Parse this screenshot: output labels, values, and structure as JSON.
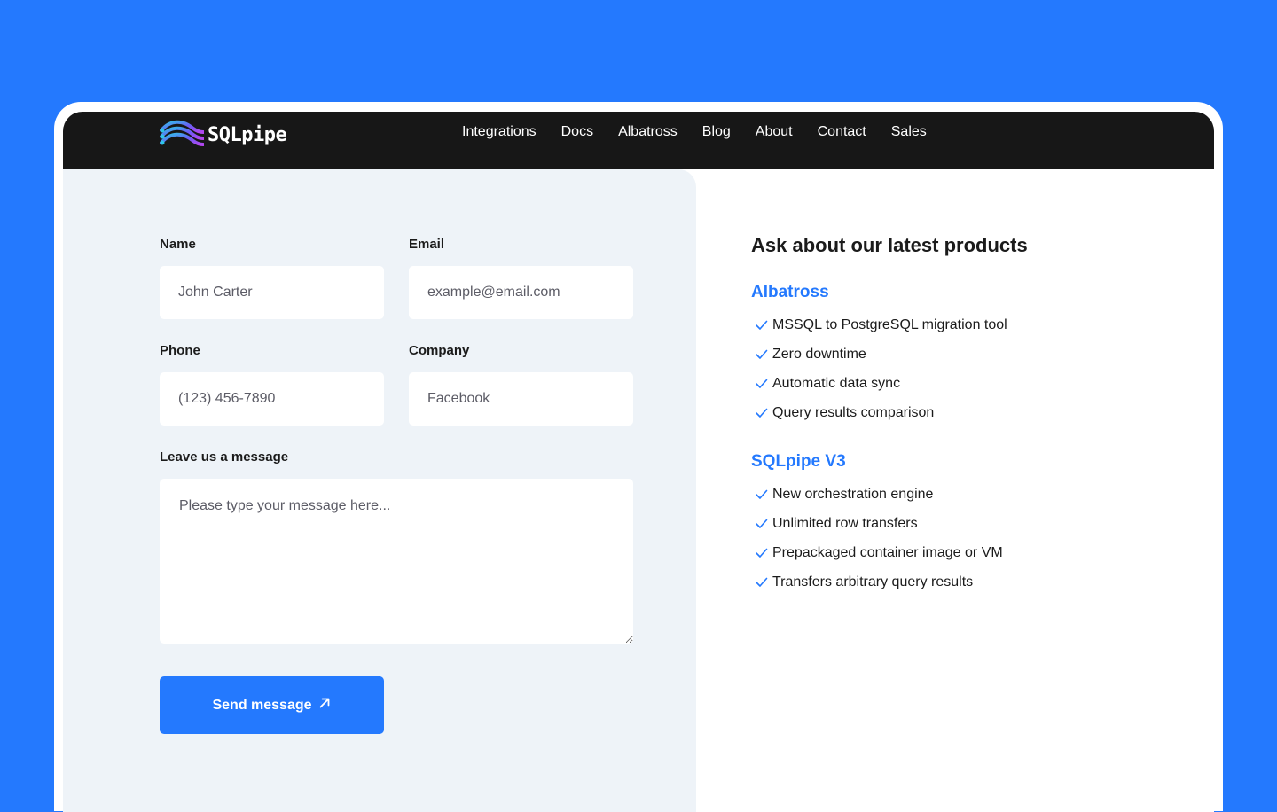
{
  "brand": {
    "name": "SQLpipe",
    "accent_color": "#2479fe",
    "nav_background": "#171717",
    "logo_icon": "sqlpipe-wave-logo-icon"
  },
  "nav": {
    "items": [
      {
        "label": "Integrations"
      },
      {
        "label": "Docs"
      },
      {
        "label": "Albatross"
      },
      {
        "label": "Blog"
      },
      {
        "label": "About"
      },
      {
        "label": "Contact"
      },
      {
        "label": "Sales"
      }
    ]
  },
  "form": {
    "name": {
      "label": "Name",
      "placeholder": "John Carter",
      "value": ""
    },
    "email": {
      "label": "Email",
      "placeholder": "example@email.com",
      "value": ""
    },
    "phone": {
      "label": "Phone",
      "placeholder": "(123) 456-7890",
      "value": ""
    },
    "company": {
      "label": "Company",
      "placeholder": "Facebook",
      "value": ""
    },
    "message": {
      "label": "Leave us a message",
      "placeholder": "Please type your message here...",
      "value": ""
    },
    "submit": {
      "label": "Send message",
      "icon": "arrow-up-right-icon"
    }
  },
  "info": {
    "title": "Ask about our latest products",
    "products": [
      {
        "name": "Albatross",
        "features": [
          "MSSQL to PostgreSQL migration tool",
          "Zero downtime",
          "Automatic data sync",
          "Query results comparison"
        ]
      },
      {
        "name": "SQLpipe V3",
        "features": [
          "New orchestration engine",
          "Unlimited row transfers",
          "Prepackaged container image or VM",
          "Transfers arbitrary query results"
        ]
      }
    ],
    "feature_icon": "checkmark-icon"
  }
}
